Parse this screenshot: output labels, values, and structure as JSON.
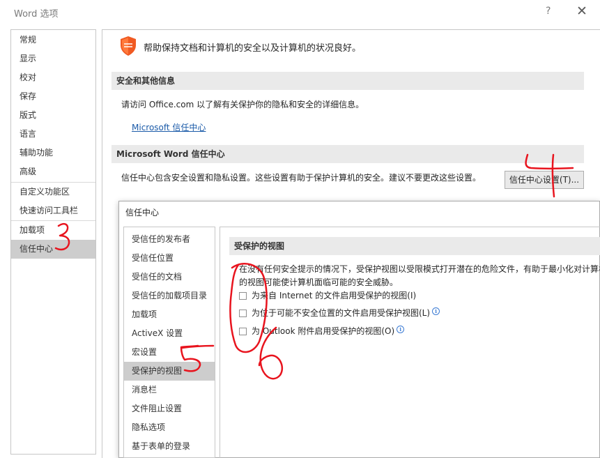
{
  "window": {
    "title": "Word 选项",
    "help_glyph": "?",
    "close_glyph": "✕"
  },
  "nav": {
    "items": [
      "常规",
      "显示",
      "校对",
      "保存",
      "版式",
      "语言",
      "辅助功能",
      "高级",
      "自定义功能区",
      "快速访问工具栏",
      "加载项",
      "信任中心"
    ],
    "selected": "信任中心"
  },
  "main": {
    "intro": "帮助保持文档和计算机的安全以及计算机的状况良好。",
    "section_privacy": "安全和其他信息",
    "privacy_text": "请访问 Office.com 以了解有关保护你的隐私和安全的详细信息。",
    "privacy_link": "Microsoft 信任中心",
    "section_tc": "Microsoft Word 信任中心",
    "tc_text": "信任中心包含安全设置和隐私设置。这些设置有助于保护计算机的安全。建议不要更改这些设置。",
    "tc_button": "信任中心设置(T)..."
  },
  "trust_center": {
    "title": "信任中心",
    "nav": [
      "受信任的发布者",
      "受信任位置",
      "受信任的文档",
      "受信任的加载项目录",
      "加载项",
      "ActiveX 设置",
      "宏设置",
      "受保护的视图",
      "消息栏",
      "文件阻止设置",
      "隐私选项",
      "基于表单的登录"
    ],
    "selected": "受保护的视图",
    "section": "受保护的视图",
    "desc_line1": "在没有任何安全提示的情况下，受保护视图以受限模式打开潜在的危险文件，有助于最小化对计算机",
    "desc_line2": "的视图可能使计算机面临可能的安全威胁。",
    "options": [
      {
        "label": "为来自 Internet 的文件启用受保护的视图(I)",
        "checked": false,
        "info": false
      },
      {
        "label": "为位于可能不安全位置的文件启用受保护视图(L)",
        "checked": false,
        "info": true
      },
      {
        "label": "为 Outlook 附件启用受保护的视图(O)",
        "checked": false,
        "info": true
      }
    ]
  },
  "colors": {
    "accent_shield": "#f05a22",
    "link": "#1a5aa8",
    "annotation": "#e8141e"
  },
  "icons": {
    "shield": "shield-icon",
    "info": "info-icon"
  }
}
